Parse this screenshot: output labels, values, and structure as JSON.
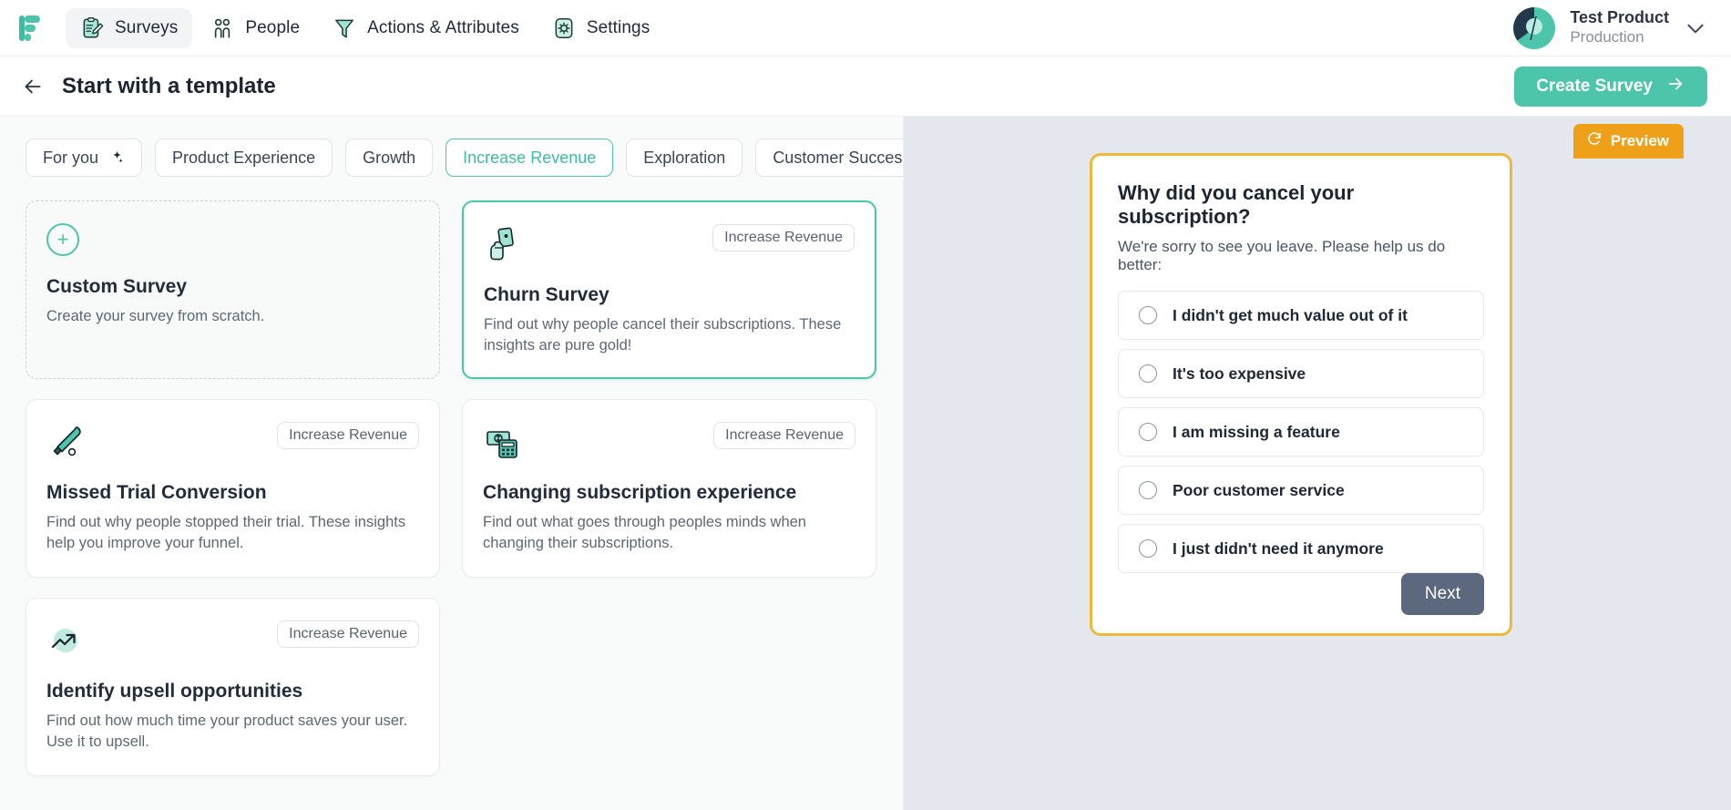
{
  "nav": {
    "logo_icon": "formbricks-logo-icon",
    "items": [
      {
        "label": "Surveys",
        "icon": "clipboard-pencil-icon",
        "active": true
      },
      {
        "label": "People",
        "icon": "people-icon",
        "active": false
      },
      {
        "label": "Actions & Attributes",
        "icon": "funnel-icon",
        "active": false
      },
      {
        "label": "Settings",
        "icon": "gear-icon",
        "active": false
      }
    ],
    "account": {
      "name": "Test Product",
      "environment": "Production",
      "avatar_icon": "pie-avatar-icon",
      "chevron_icon": "chevron-down-icon"
    }
  },
  "subheader": {
    "back_icon": "arrow-left-icon",
    "title": "Start with a template",
    "create_label": "Create Survey",
    "create_icon": "arrow-right-icon"
  },
  "tabs": [
    {
      "label": "For you",
      "icon": "sparkles-icon",
      "selected": false
    },
    {
      "label": "Product Experience",
      "icon": "",
      "selected": false
    },
    {
      "label": "Growth",
      "icon": "",
      "selected": false
    },
    {
      "label": "Increase Revenue",
      "icon": "",
      "selected": true
    },
    {
      "label": "Exploration",
      "icon": "",
      "selected": false
    },
    {
      "label": "Customer Success",
      "icon": "",
      "selected": false
    }
  ],
  "templates": [
    {
      "kind": "custom",
      "icon": "plus-circle-icon",
      "badge": "",
      "title": "Custom Survey",
      "description": "Create your survey from scratch.",
      "selected": false
    },
    {
      "kind": "template",
      "icon": "hand-phone-icon",
      "badge": "Increase Revenue",
      "title": "Churn Survey",
      "description": "Find out why people cancel their subscriptions. These insights are pure gold!",
      "selected": true
    },
    {
      "kind": "template",
      "icon": "baseball-bat-icon",
      "badge": "Increase Revenue",
      "title": "Missed Trial Conversion",
      "description": "Find out why people stopped their trial. These insights help you improve your funnel.",
      "selected": false
    },
    {
      "kind": "template",
      "icon": "money-calculator-icon",
      "badge": "Increase Revenue",
      "title": "Changing subscription experience",
      "description": "Find out what goes through peoples minds when changing their subscriptions.",
      "selected": false
    },
    {
      "kind": "template",
      "icon": "trend-up-icon",
      "badge": "Increase Revenue",
      "title": "Identify upsell opportunities",
      "description": "Find out how much time your product saves your user. Use it to upsell.",
      "selected": false
    }
  ],
  "preview": {
    "tab_label": "Preview",
    "tab_icon": "refresh-icon",
    "question": "Why did you cancel your subscription?",
    "subtitle": "We're sorry to see you leave. Please help us do better:",
    "options": [
      "I didn't get much value out of it",
      "It's too expensive",
      "I am missing a feature",
      "Poor customer service",
      "I just didn't need it anymore"
    ],
    "next_label": "Next"
  },
  "colors": {
    "accent_teal": "#4cc5ab",
    "preview_orange": "#eda018",
    "preview_border": "#eeb93b",
    "next_button": "#5b687e",
    "right_pane_bg": "#e4e8ee"
  }
}
